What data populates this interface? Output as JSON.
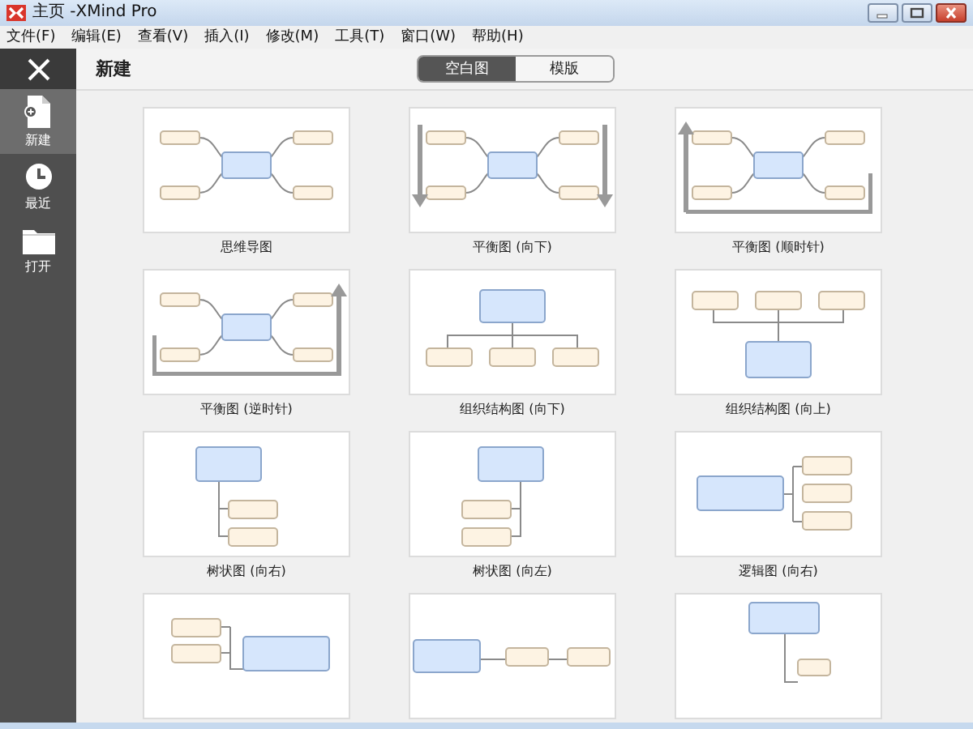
{
  "window": {
    "title": "主页 -XMind Pro"
  },
  "menu": [
    "文件(F)",
    "编辑(E)",
    "查看(V)",
    "插入(I)",
    "修改(M)",
    "工具(T)",
    "窗口(W)",
    "帮助(H)"
  ],
  "sidebar": {
    "items": [
      {
        "label": "新建",
        "selected": true
      },
      {
        "label": "最近",
        "selected": false
      },
      {
        "label": "打开",
        "selected": false
      }
    ]
  },
  "header": {
    "title": "新建",
    "tabs": [
      {
        "label": "空白图",
        "selected": true
      },
      {
        "label": "模版",
        "selected": false
      }
    ]
  },
  "templates": [
    {
      "kind": "mindmap",
      "label": "思维导图"
    },
    {
      "kind": "balance-down",
      "label": "平衡图 (向下)"
    },
    {
      "kind": "balance-cw",
      "label": "平衡图 (顺时针)"
    },
    {
      "kind": "balance-ccw",
      "label": "平衡图 (逆时针)"
    },
    {
      "kind": "org-down",
      "label": "组织结构图 (向下)"
    },
    {
      "kind": "org-up",
      "label": "组织结构图 (向上)"
    },
    {
      "kind": "tree-right",
      "label": "树状图 (向右)"
    },
    {
      "kind": "tree-left",
      "label": "树状图 (向左)"
    },
    {
      "kind": "logic-right",
      "label": "逻辑图 (向右)"
    },
    {
      "kind": "logic-left"
    },
    {
      "kind": "timeline"
    },
    {
      "kind": "tree-down"
    }
  ]
}
